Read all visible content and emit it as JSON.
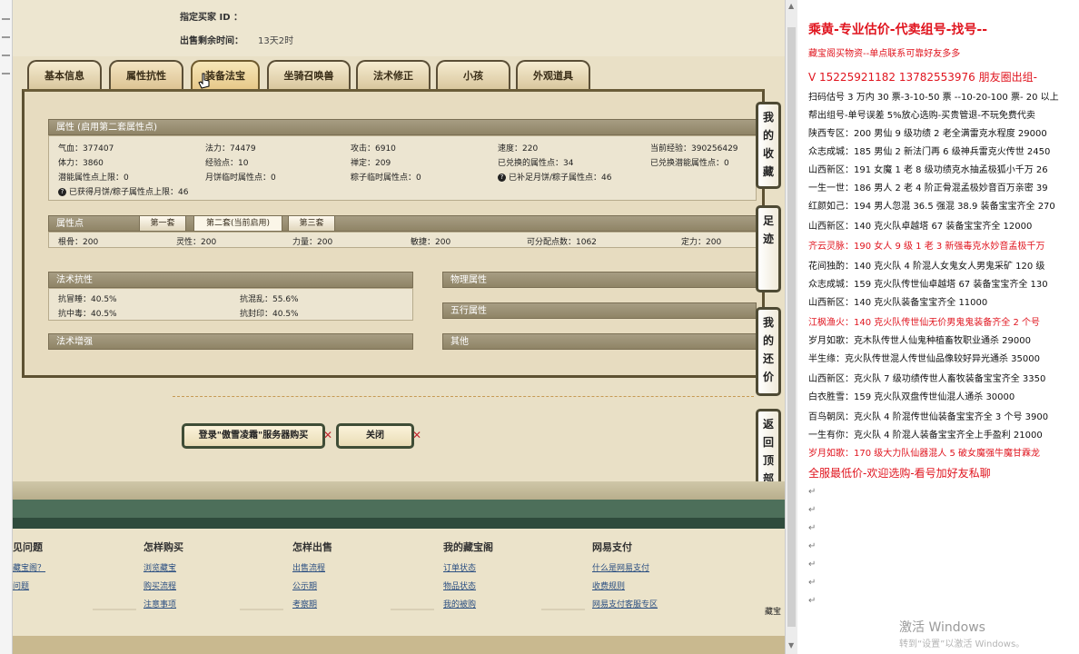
{
  "seller_info": {
    "buyer_id_label": "指定买家 ID ：",
    "time_label": "出售剩余时间：",
    "time_value": "13天2时"
  },
  "tabs": [
    "基本信息",
    "属性抗性",
    "装备法宝",
    "坐骑召唤兽",
    "法术修正",
    "小孩",
    "外观道具"
  ],
  "attr_section": {
    "header": "属性 (启用第二套属性点)",
    "rows": [
      [
        "气血：377407",
        "法力：74479",
        "攻击：6910",
        "速度：220",
        "当前经验：390256429"
      ],
      [
        "体力：3860",
        "经验点：10",
        "禅定：209",
        "已兑换的属性点：34",
        "已兑换潜能属性点：0"
      ],
      [
        "潜能属性点上限：0",
        "月饼临时属性点：0",
        "粽子临时属性点：0",
        "已补足月饼/粽子属性点：46",
        ""
      ]
    ],
    "extra": "已获得月饼/粽子属性点上限：46"
  },
  "points_section": {
    "header": "属性点",
    "subtabs": [
      "第一套",
      "第二套(当前启用)",
      "第三套"
    ],
    "values": [
      "根骨：200",
      "灵性：200",
      "力量：200",
      "敏捷：200",
      "可分配点数：1062",
      "定力：200"
    ]
  },
  "resist_section": {
    "header": "法术抗性",
    "values": [
      "抗冒睡：40.5%",
      "抗混乱：55.6%",
      "抗中毒：40.5%",
      "抗封印：40.5%"
    ]
  },
  "enhance_header": "法术增强",
  "right_headers": [
    "物理属性",
    "五行属性",
    "其他"
  ],
  "side_buttons": [
    "我的收藏",
    "足迹",
    "我的还价",
    "返回顶部"
  ],
  "buttons": {
    "login": "登录\"傲雪凌霜\"服务器购买",
    "close": "关闭"
  },
  "footer": {
    "columns": [
      {
        "head": "见问题",
        "links": [
          "藏宝阁？",
          "问题"
        ]
      },
      {
        "head": "怎样购买",
        "links": [
          "浏览藏宝",
          "购买流程",
          "注意事项"
        ]
      },
      {
        "head": "怎样出售",
        "links": [
          "出售流程",
          "公示期",
          "考察期"
        ]
      },
      {
        "head": "我的藏宝阁",
        "links": [
          "订单状态",
          "物品状态",
          "我的被购"
        ]
      },
      {
        "head": "网易支付",
        "links": [
          "什么是网易支付",
          "收费规则",
          "网易支付客服专区"
        ]
      }
    ],
    "corner": "藏宝"
  },
  "doc": {
    "lines": [
      {
        "t": "乘黄-专业估价-代卖组号-找号--",
        "s": "big"
      },
      {
        "t": "藏宝阁买物资--单点联系可靠好友多多",
        "s": "red"
      },
      {
        "t": "V 15225921182   13782553976 朋友圈出组-",
        "s": "mid"
      },
      {
        "t": "扫码估号 3 万内 30 票-3-10-50 票  --10-20-100 票- 20 以上",
        "s": ""
      },
      {
        "t": "帮出组号-单号误差 5%放心选购-买贵管退-不玩免费代卖",
        "s": ""
      },
      {
        "t": "陕西专区：200 男仙 9 级功绩 2 老全满雷克水程度 29000",
        "s": ""
      },
      {
        "t": "众志成城：185 男仙 2 新法门再 6 级神兵雷克火传世 2450",
        "s": ""
      },
      {
        "t": "山西新区：191 女魔 1 老 8 级功绩克水抽孟极狐小千万 26",
        "s": ""
      },
      {
        "t": "一生一世：186 男人 2 老 4 阶正骨混孟极妙音百万亲密 39",
        "s": ""
      },
      {
        "t": "红颜如己：194 男人忽混 36.5 强混 38.9 装备宝宝齐全 270",
        "s": ""
      },
      {
        "t": "山西新区：140 克火队卓越塔 67 装备宝宝齐全 12000",
        "s": ""
      },
      {
        "t": "齐云灵脉：190 女人 9 级 1 老 3 新强毒克水妙音孟极千万",
        "s": "red"
      },
      {
        "t": "花间独酌：140 克火队 4 阶混人女鬼女人男鬼采矿 120 级",
        "s": ""
      },
      {
        "t": "众志成城：159 克火队传世仙卓越塔 67 装备宝宝齐全 130",
        "s": ""
      },
      {
        "t": "山西新区：140 克火队装备宝宝齐全 11000",
        "s": ""
      },
      {
        "t": "江枫渔火：140 克火队传世仙无价男鬼鬼装备齐全 2 个号",
        "s": "red"
      },
      {
        "t": "岁月如歌：克木队传世人仙鬼种植畜牧职业通杀 29000",
        "s": ""
      },
      {
        "t": "半生缘：克火队传世混人传世仙品像较好异光通杀 35000",
        "s": ""
      },
      {
        "t": "山西新区：克火队 7 级功绩传世人畜牧装备宝宝齐全 3350",
        "s": ""
      },
      {
        "t": "白衣胜雪：159 克火队双盘传世仙混人通杀 30000",
        "s": ""
      },
      {
        "t": "百鸟朝凤：克火队 4 阶混传世仙装备宝宝齐全 3 个号 3900",
        "s": ""
      },
      {
        "t": "一生有你：克火队 4 阶混人装备宝宝齐全上手盈利 21000",
        "s": ""
      },
      {
        "t": "岁月如歌：170 级大力队仙器混人 5 破女魔强牛魔甘霖龙",
        "s": "red"
      },
      {
        "t": "全服最低价-欢迎选购-看号加好友私聊",
        "s": "mid"
      },
      {
        "t": "↵",
        "s": "blank"
      },
      {
        "t": "↵",
        "s": "blank"
      },
      {
        "t": "↵",
        "s": "blank"
      },
      {
        "t": "↵",
        "s": "blank"
      },
      {
        "t": "↵",
        "s": "blank"
      },
      {
        "t": "↵",
        "s": "blank"
      },
      {
        "t": "↵",
        "s": "blank"
      }
    ],
    "watermark": "激活 Windows",
    "watermark_sub": "转到“设置”以激活 Windows。"
  }
}
